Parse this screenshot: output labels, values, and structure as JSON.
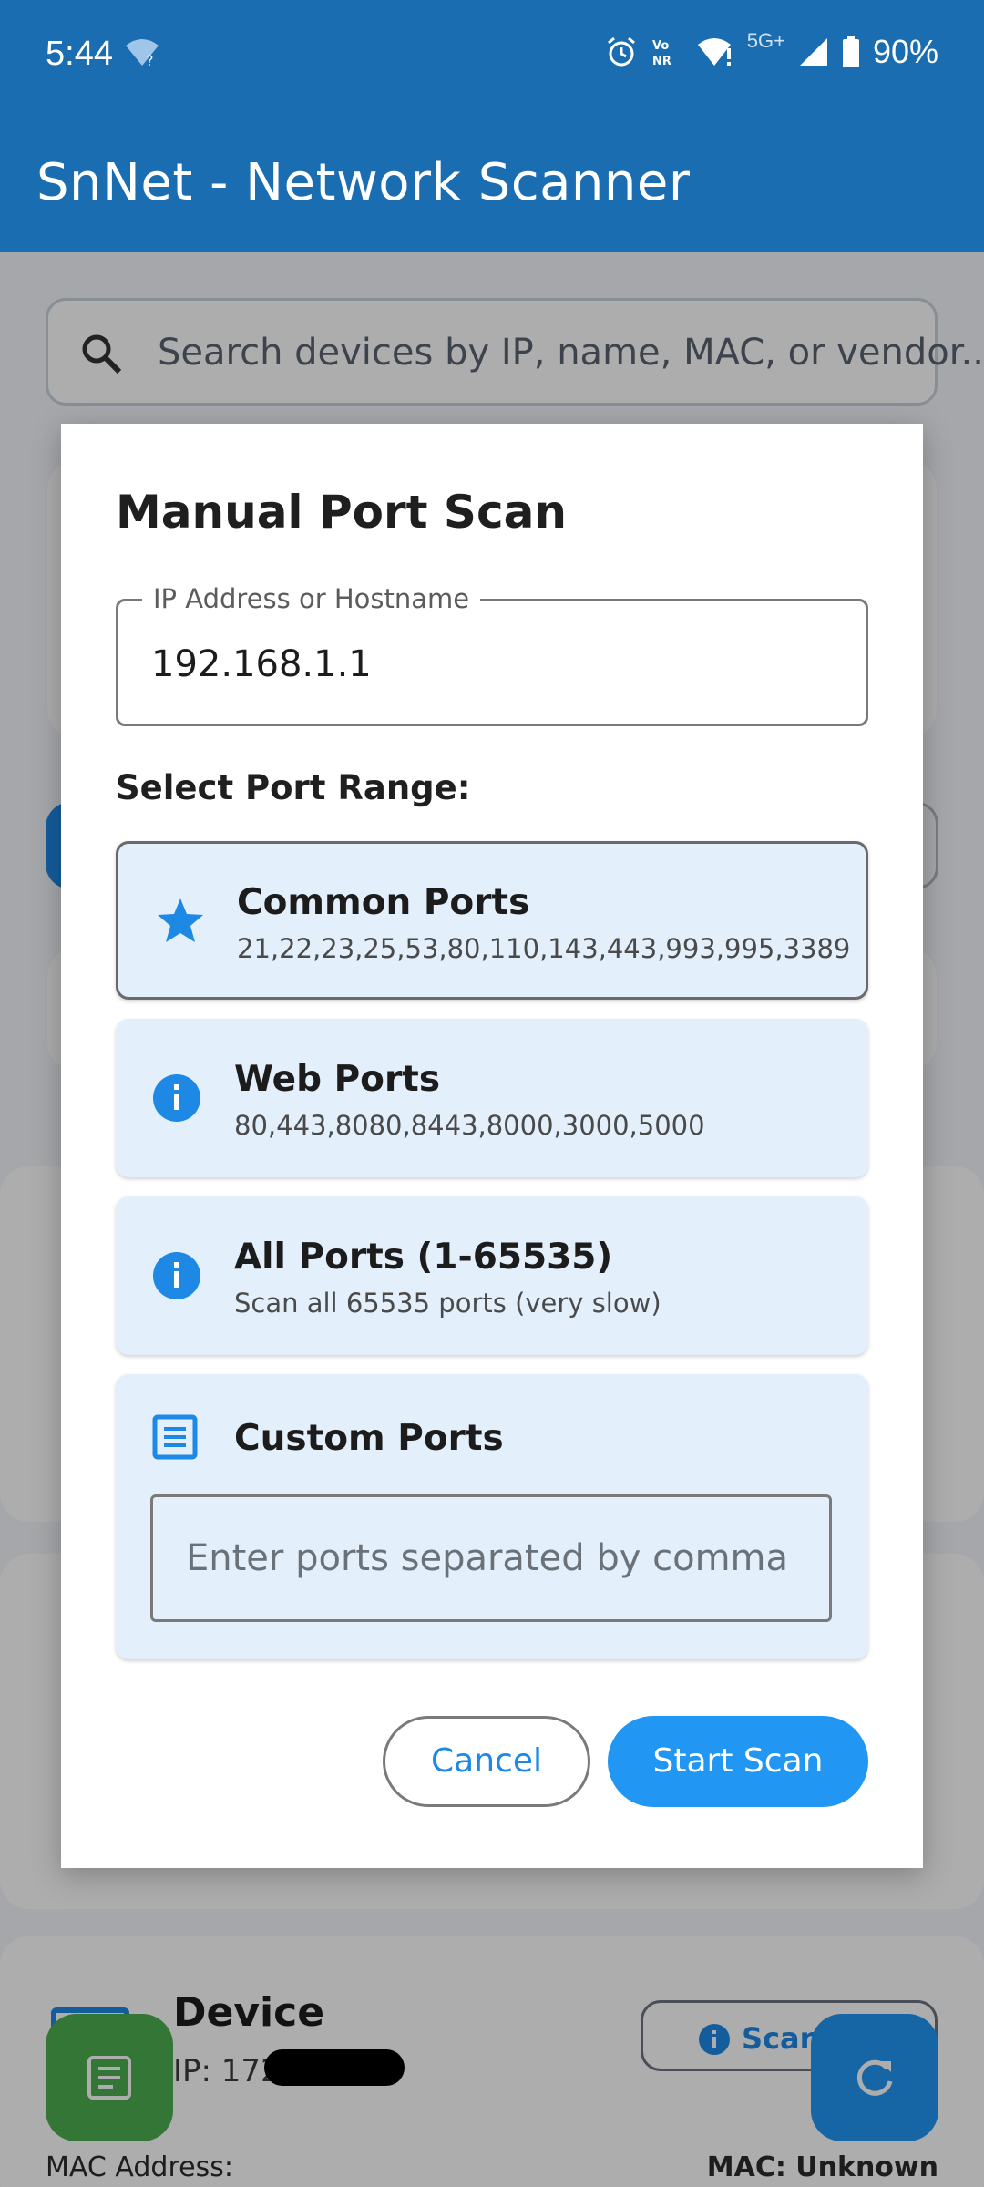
{
  "status_bar": {
    "time": "5:44",
    "battery": "90%",
    "network_label": "5G+",
    "icons": [
      "wifi-question-icon",
      "alarm-icon",
      "vonr-icon",
      "wifi-alert-icon",
      "signal-icon",
      "battery-icon"
    ]
  },
  "app_bar": {
    "title": "SnNet - Network Scanner"
  },
  "search": {
    "placeholder": "Search devices by IP, name, MAC, or vendor..."
  },
  "background_device": {
    "title": "Device",
    "ip_prefix": "IP: 172.",
    "mac_label": "MAC Address:",
    "mac_value": "MAC: Unknown",
    "scan_button_label": "Scan"
  },
  "dialog": {
    "title": "Manual Port Scan",
    "ip_field": {
      "label": "IP Address or Hostname",
      "value": "192.168.1.1"
    },
    "range_label": "Select Port Range:",
    "options": [
      {
        "title": "Common Ports",
        "subtitle": "21,22,23,25,53,80,110,143,443,993,995,3389",
        "icon": "star-icon",
        "selected": true
      },
      {
        "title": "Web Ports",
        "subtitle": "80,443,8080,8443,8000,3000,5000",
        "icon": "info-icon",
        "selected": false
      },
      {
        "title": "All Ports (1-65535)",
        "subtitle": "Scan all 65535 ports (very slow)",
        "icon": "info-icon",
        "selected": false
      },
      {
        "title": "Custom Ports",
        "icon": "list-icon",
        "selected": false,
        "input_placeholder": "Enter ports separated by comma"
      }
    ],
    "cancel_label": "Cancel",
    "start_label": "Start Scan"
  },
  "colors": {
    "app_bar": "#1b6db1",
    "accent": "#2196f3",
    "option_bg": "#e3f0fb",
    "fab_left": "#4caf50"
  }
}
